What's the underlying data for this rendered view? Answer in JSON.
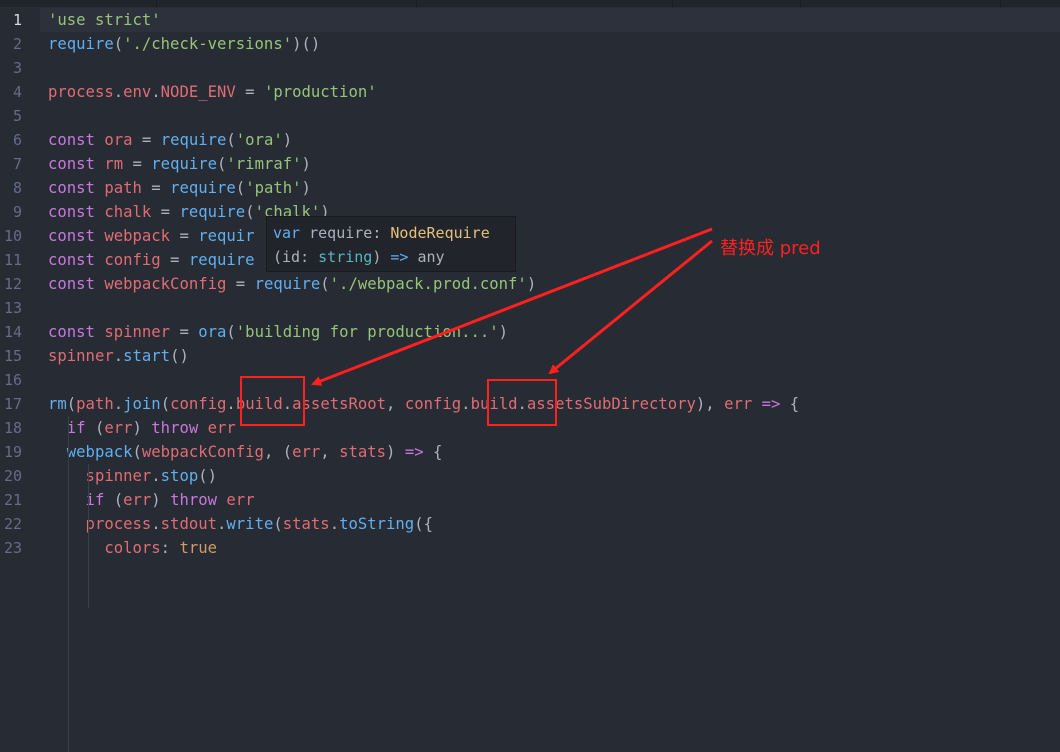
{
  "editor": {
    "line_numbers": [
      "1",
      "2",
      "3",
      "4",
      "5",
      "6",
      "7",
      "8",
      "9",
      "10",
      "11",
      "12",
      "13",
      "14",
      "15",
      "16",
      "17",
      "18",
      "19",
      "20",
      "21",
      "22",
      "23"
    ],
    "lines": [
      [
        [
          "s",
          "'use strict'"
        ]
      ],
      [
        [
          "f",
          "require"
        ],
        [
          "p",
          "("
        ],
        [
          "s",
          "'./check-versions'"
        ],
        [
          "p",
          ")()"
        ]
      ],
      [],
      [
        [
          "v",
          "process"
        ],
        [
          "p",
          "."
        ],
        [
          "v",
          "env"
        ],
        [
          "p",
          "."
        ],
        [
          "v",
          "NODE_ENV"
        ],
        [
          "p",
          " = "
        ],
        [
          "s",
          "'production'"
        ]
      ],
      [],
      [
        [
          "k",
          "const"
        ],
        [
          "v",
          " ora"
        ],
        [
          "p",
          " = "
        ],
        [
          "f",
          "require"
        ],
        [
          "p",
          "("
        ],
        [
          "s",
          "'ora'"
        ],
        [
          "p",
          ")"
        ]
      ],
      [
        [
          "k",
          "const"
        ],
        [
          "v",
          " rm"
        ],
        [
          "p",
          " = "
        ],
        [
          "f",
          "require"
        ],
        [
          "p",
          "("
        ],
        [
          "s",
          "'rimraf'"
        ],
        [
          "p",
          ")"
        ]
      ],
      [
        [
          "k",
          "const"
        ],
        [
          "v",
          " path"
        ],
        [
          "p",
          " = "
        ],
        [
          "f",
          "require"
        ],
        [
          "p",
          "("
        ],
        [
          "s",
          "'path'"
        ],
        [
          "p",
          ")"
        ]
      ],
      [
        [
          "k",
          "const"
        ],
        [
          "v",
          " chalk"
        ],
        [
          "p",
          " = "
        ],
        [
          "f",
          "require"
        ],
        [
          "p",
          "("
        ],
        [
          "s",
          "'chalk'"
        ],
        [
          "p",
          ")"
        ]
      ],
      [
        [
          "k",
          "const"
        ],
        [
          "v",
          " webpack"
        ],
        [
          "p",
          " = "
        ],
        [
          "f",
          "requir"
        ]
      ],
      [
        [
          "k",
          "const"
        ],
        [
          "v",
          " config"
        ],
        [
          "p",
          " = "
        ],
        [
          "f",
          "require"
        ]
      ],
      [
        [
          "k",
          "const"
        ],
        [
          "v",
          " webpackConfig"
        ],
        [
          "p",
          " = "
        ],
        [
          "f",
          "require"
        ],
        [
          "p",
          "("
        ],
        [
          "s",
          "'./webpack.prod.conf'"
        ],
        [
          "p",
          ")"
        ]
      ],
      [],
      [
        [
          "k",
          "const"
        ],
        [
          "v",
          " spinner"
        ],
        [
          "p",
          " = "
        ],
        [
          "f",
          "ora"
        ],
        [
          "p",
          "("
        ],
        [
          "s",
          "'building for production...'"
        ],
        [
          "p",
          ")"
        ]
      ],
      [
        [
          "v",
          "spinner"
        ],
        [
          "p",
          "."
        ],
        [
          "f",
          "start"
        ],
        [
          "p",
          "()"
        ]
      ],
      [],
      [
        [
          "f",
          "rm"
        ],
        [
          "p",
          "("
        ],
        [
          "v",
          "path"
        ],
        [
          "p",
          "."
        ],
        [
          "f",
          "join"
        ],
        [
          "p",
          "("
        ],
        [
          "v",
          "config"
        ],
        [
          "p",
          "."
        ],
        [
          "v",
          "build"
        ],
        [
          "p",
          "."
        ],
        [
          "v",
          "assetsRoot"
        ],
        [
          "p",
          ", "
        ],
        [
          "v",
          "config"
        ],
        [
          "p",
          "."
        ],
        [
          "v",
          "build"
        ],
        [
          "p",
          "."
        ],
        [
          "v",
          "assetsSubDirectory"
        ],
        [
          "p",
          "), "
        ],
        [
          "v",
          "err"
        ],
        [
          "k",
          " =>"
        ],
        [
          "p",
          " {"
        ]
      ],
      [
        [
          "k",
          "  if"
        ],
        [
          "p",
          " ("
        ],
        [
          "v",
          "err"
        ],
        [
          "p",
          ") "
        ],
        [
          "k",
          "throw"
        ],
        [
          "v",
          " err"
        ]
      ],
      [
        [
          "f",
          "  webpack"
        ],
        [
          "p",
          "("
        ],
        [
          "v",
          "webpackConfig"
        ],
        [
          "p",
          ", ("
        ],
        [
          "v",
          "err"
        ],
        [
          "p",
          ", "
        ],
        [
          "v",
          "stats"
        ],
        [
          "p",
          ") "
        ],
        [
          "k",
          "=>"
        ],
        [
          "p",
          " {"
        ]
      ],
      [
        [
          "v",
          "    spinner"
        ],
        [
          "p",
          "."
        ],
        [
          "f",
          "stop"
        ],
        [
          "p",
          "()"
        ]
      ],
      [
        [
          "k",
          "    if"
        ],
        [
          "p",
          " ("
        ],
        [
          "v",
          "err"
        ],
        [
          "p",
          ") "
        ],
        [
          "k",
          "throw"
        ],
        [
          "v",
          " err"
        ]
      ],
      [
        [
          "v",
          "    process"
        ],
        [
          "p",
          "."
        ],
        [
          "v",
          "stdout"
        ],
        [
          "p",
          "."
        ],
        [
          "f",
          "write"
        ],
        [
          "p",
          "("
        ],
        [
          "v",
          "stats"
        ],
        [
          "p",
          "."
        ],
        [
          "f",
          "toString"
        ],
        [
          "p",
          "({"
        ]
      ],
      [
        [
          "v",
          "      colors"
        ],
        [
          "p",
          ": "
        ],
        [
          "c",
          "true"
        ]
      ]
    ]
  },
  "hover_tooltip": {
    "line1": [
      [
        "hk",
        "var"
      ],
      [
        "p",
        " require: "
      ],
      [
        "ht",
        "NodeRequire"
      ]
    ],
    "line2": [
      [
        "p",
        "(id: "
      ],
      [
        "hs",
        "string"
      ],
      [
        "p",
        ") "
      ],
      [
        "hk",
        "=>"
      ],
      [
        "p",
        " any"
      ]
    ]
  },
  "annotation": {
    "label": "替换成 pred",
    "color": "#ff2020"
  },
  "colors": {
    "background": "#272b33",
    "keyword": "#c678dd",
    "string": "#98c379",
    "function": "#61afef",
    "variable": "#e06c75",
    "line_number": "#636d83"
  }
}
